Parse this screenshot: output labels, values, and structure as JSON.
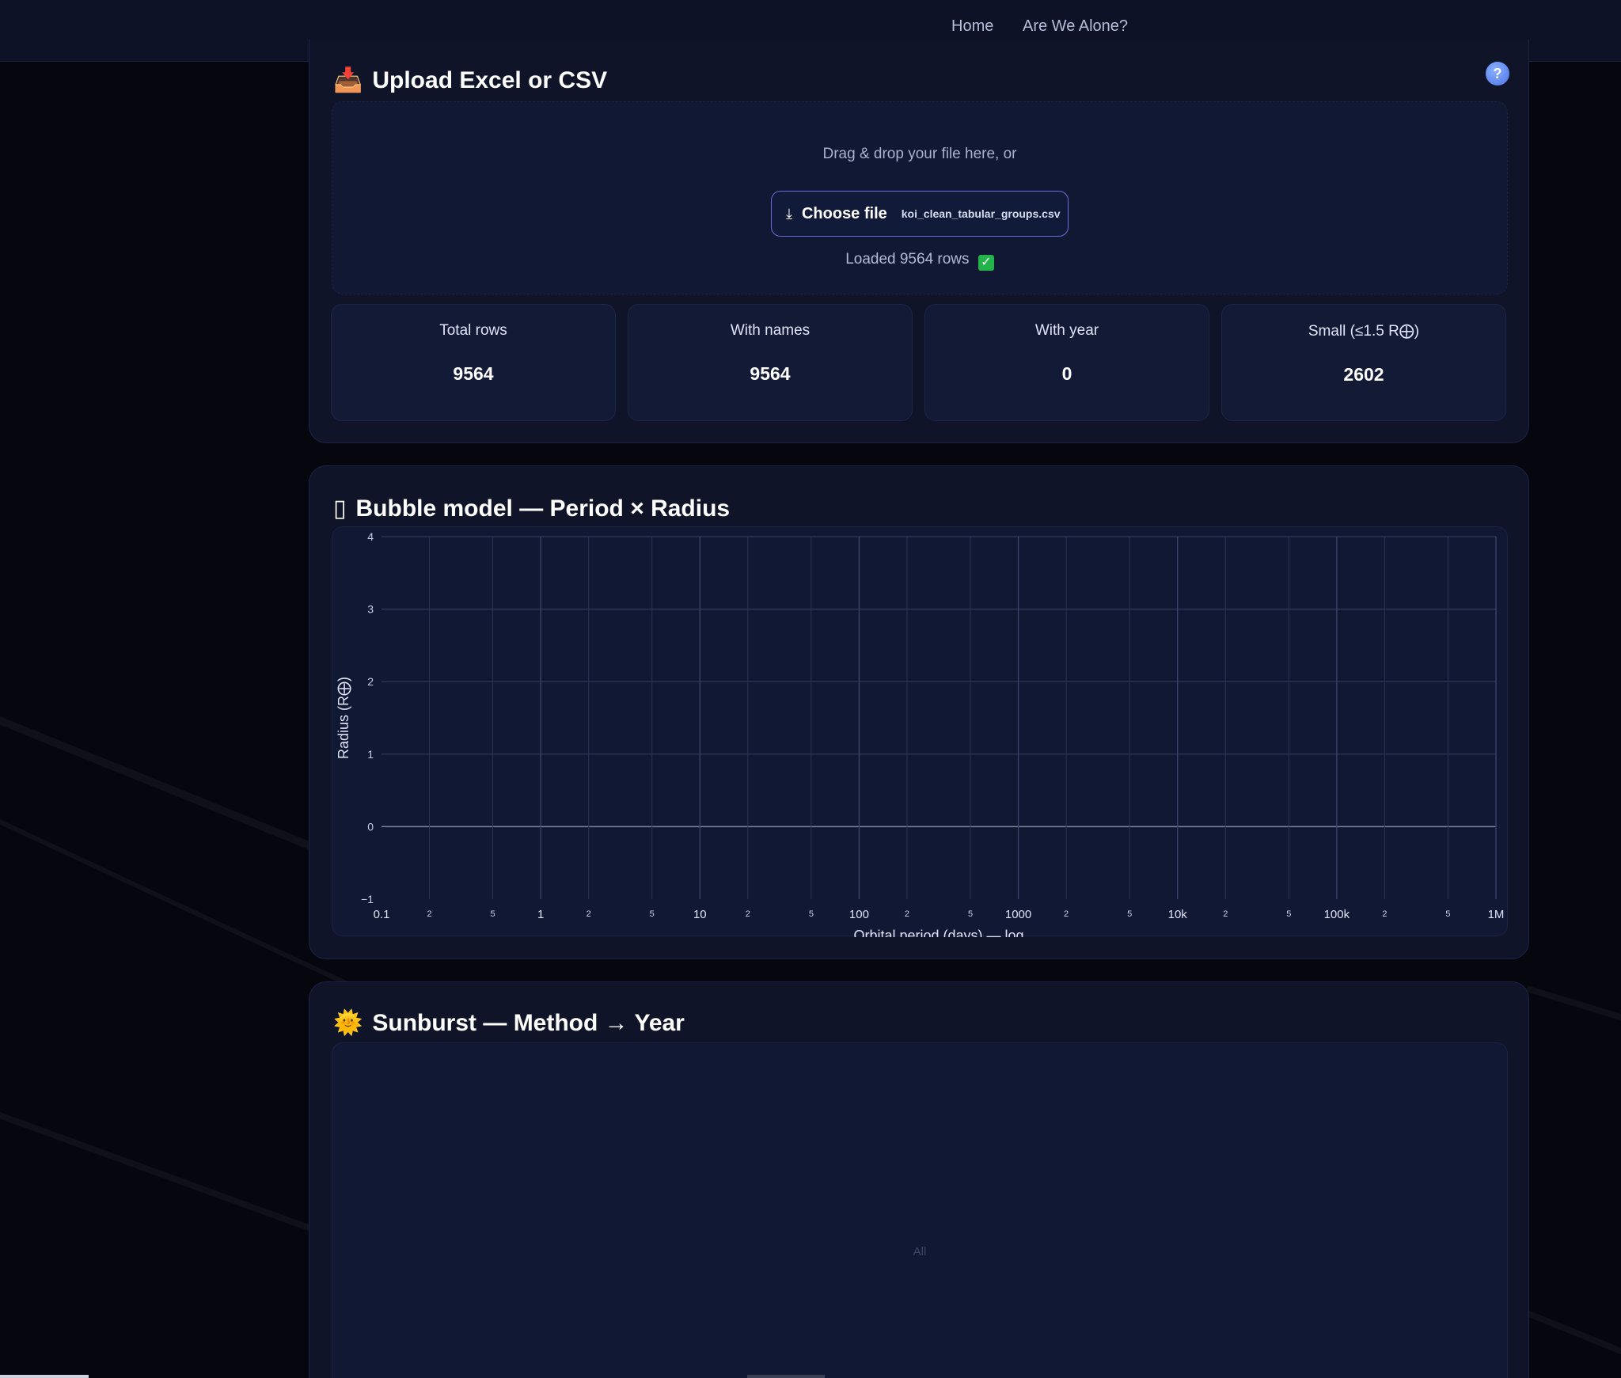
{
  "nav": {
    "home": "Home",
    "alone": "Are We Alone?"
  },
  "upload": {
    "icon": "📥",
    "title": "Upload Excel or CSV",
    "help": "?",
    "drop_text": "Drag & drop your file here, or",
    "choose_icon": "⤓",
    "choose_label": "Choose file",
    "file_name": "koi_clean_tabular_groups.csv",
    "loaded_text": "Loaded 9564 rows",
    "check": "✓",
    "stats": [
      {
        "label": "Total rows",
        "value": "9564"
      },
      {
        "label": "With names",
        "value": "9564"
      },
      {
        "label": "With year",
        "value": "0"
      },
      {
        "label": "Small (≤1.5 R⨁)",
        "value": "2602"
      }
    ]
  },
  "bubble": {
    "icon": "▯",
    "title": "Bubble model — Period × Radius"
  },
  "sunburst": {
    "icon": "🌞",
    "title": "Sunburst — Method → Year",
    "center": "All"
  },
  "chart_data": {
    "type": "scatter",
    "title": "Bubble model — Period × Radius",
    "xlabel": "Orbital period (days) — log",
    "ylabel": "Radius (R⨁)",
    "x_scale": "log",
    "xlim": [
      0.1,
      1000000
    ],
    "ylim": [
      -1,
      4
    ],
    "x_major_ticks": [
      {
        "value": 0.1,
        "label": "0.1"
      },
      {
        "value": 1,
        "label": "1"
      },
      {
        "value": 10,
        "label": "10"
      },
      {
        "value": 100,
        "label": "100"
      },
      {
        "value": 1000,
        "label": "1000"
      },
      {
        "value": 10000,
        "label": "10k"
      },
      {
        "value": 100000,
        "label": "100k"
      },
      {
        "value": 1000000,
        "label": "1M"
      }
    ],
    "x_minor_labels": [
      "2",
      "5"
    ],
    "y_ticks": [
      -1,
      0,
      1,
      2,
      3,
      4
    ],
    "grid": true,
    "series": []
  }
}
